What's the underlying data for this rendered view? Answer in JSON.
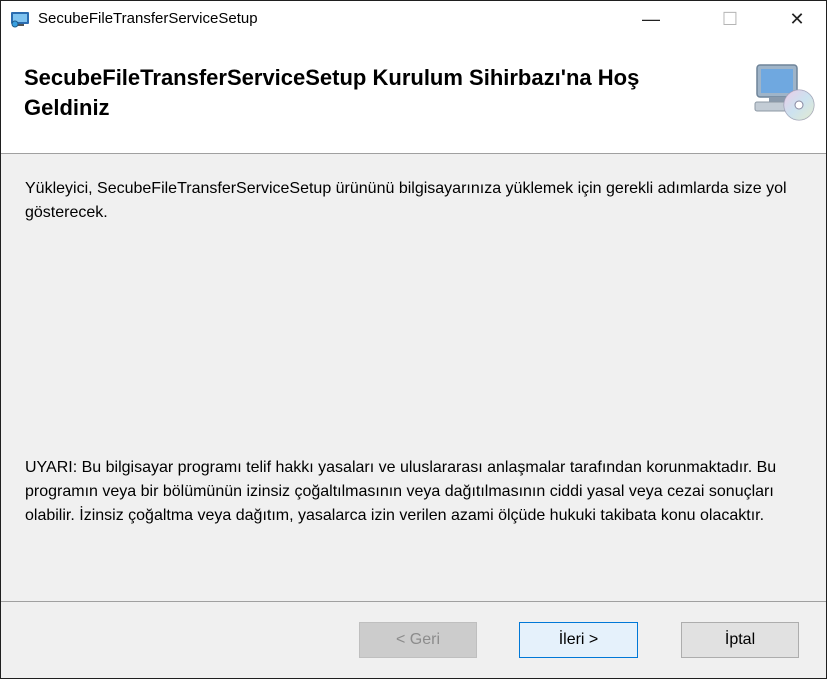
{
  "window": {
    "title": "SecubeFileTransferServiceSetup",
    "minimize_glyph": "—",
    "maximize_glyph": "☐",
    "close_glyph": "✕"
  },
  "banner": {
    "title": "SecubeFileTransferServiceSetup Kurulum Sihirbazı'na Hoş Geldiniz",
    "icon": "computer-cd-icon"
  },
  "body": {
    "intro": "Yükleyici, SecubeFileTransferServiceSetup ürününü bilgisayarınıza yüklemek için gerekli adımlarda size yol gösterecek.",
    "warning": "UYARI: Bu bilgisayar programı telif hakkı yasaları ve uluslararası anlaşmalar tarafından korunmaktadır. Bu programın veya bir bölümünün izinsiz çoğaltılmasının veya dağıtılmasının ciddi yasal veya cezai sonuçları olabilir. İzinsiz çoğaltma veya dağıtım, yasalarca izin verilen azami ölçüde hukuki takibata konu olacaktır."
  },
  "buttons": {
    "back": "< Geri",
    "next": "İleri >",
    "cancel": "İptal"
  },
  "colors": {
    "dialog_bg": "#f0f0f0",
    "focus_border": "#0078d7"
  }
}
